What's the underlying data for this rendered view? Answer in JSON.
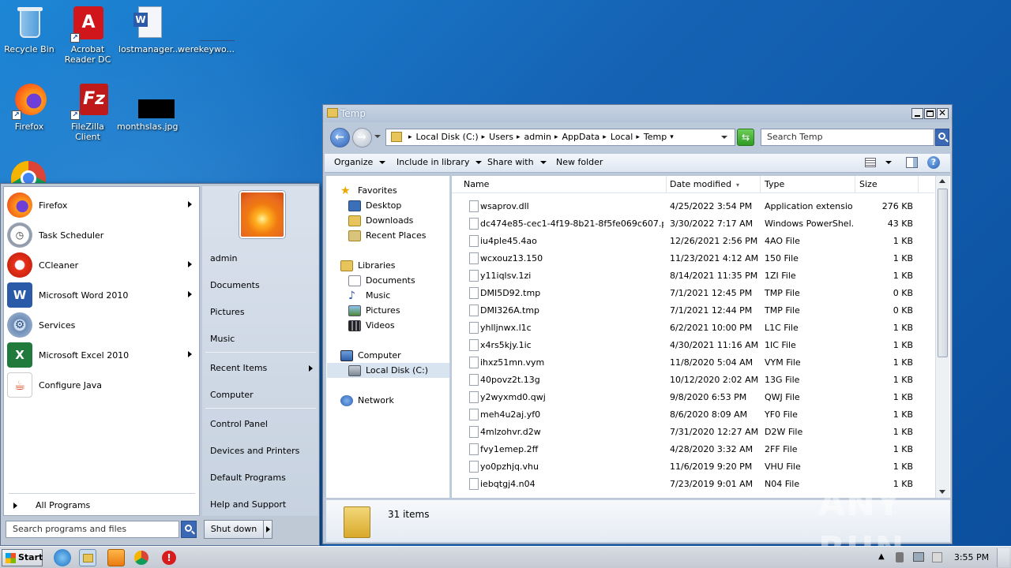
{
  "desktop": {
    "icons": [
      {
        "label": "Recycle Bin"
      },
      {
        "label": "Acrobat Reader DC"
      },
      {
        "label": "lostmanager..."
      },
      {
        "label": "werekeywo..."
      },
      {
        "label": "Firefox"
      },
      {
        "label": "FileZilla Client"
      },
      {
        "label": "monthslas.jpg"
      }
    ]
  },
  "start_menu": {
    "programs": [
      {
        "label": "Firefox",
        "has_submenu": true
      },
      {
        "label": "Task Scheduler",
        "has_submenu": false
      },
      {
        "label": "CCleaner",
        "has_submenu": true
      },
      {
        "label": "Microsoft Word 2010",
        "has_submenu": true
      },
      {
        "label": "Services",
        "has_submenu": false
      },
      {
        "label": "Microsoft Excel 2010",
        "has_submenu": true
      },
      {
        "label": "Configure Java",
        "has_submenu": false
      }
    ],
    "all_programs": "All Programs",
    "search_placeholder": "Search programs and files",
    "right_items": {
      "admin": "admin",
      "documents": "Documents",
      "pictures": "Pictures",
      "music": "Music",
      "recent": "Recent Items",
      "computer": "Computer",
      "control_panel": "Control Panel",
      "devices": "Devices and Printers",
      "default_programs": "Default Programs",
      "help": "Help and Support"
    },
    "shutdown": "Shut down"
  },
  "explorer": {
    "title": "Temp",
    "breadcrumbs": [
      "Local Disk (C:)",
      "Users",
      "admin",
      "AppData",
      "Local",
      "Temp"
    ],
    "search_placeholder": "Search Temp",
    "toolbar": {
      "organize": "Organize",
      "include": "Include in library",
      "share": "Share with",
      "new_folder": "New folder"
    },
    "nav": {
      "favorites": "Favorites",
      "desktop": "Desktop",
      "downloads": "Downloads",
      "recent": "Recent Places",
      "libraries": "Libraries",
      "documents": "Documents",
      "music": "Music",
      "pictures": "Pictures",
      "videos": "Videos",
      "computer": "Computer",
      "local_disk": "Local Disk (C:)",
      "network": "Network"
    },
    "columns": {
      "name": "Name",
      "date": "Date modified",
      "type": "Type",
      "size": "Size"
    },
    "files": [
      {
        "name": "wsaprov.dll",
        "date": "4/25/2022 3:54 PM",
        "type": "Application extension",
        "size": "276 KB"
      },
      {
        "name": "dc474e85-cec1-4f19-8b21-8f5fe069c607.ps1",
        "date": "3/30/2022 7:17 AM",
        "type": "Windows PowerShel...",
        "size": "43 KB"
      },
      {
        "name": "iu4ple45.4ao",
        "date": "12/26/2021 2:56 PM",
        "type": "4AO File",
        "size": "1 KB"
      },
      {
        "name": "wcxouz13.150",
        "date": "11/23/2021 4:12 AM",
        "type": "150 File",
        "size": "1 KB"
      },
      {
        "name": "y11iqlsv.1zi",
        "date": "8/14/2021 11:35 PM",
        "type": "1ZI File",
        "size": "1 KB"
      },
      {
        "name": "DMI5D92.tmp",
        "date": "7/1/2021 12:45 PM",
        "type": "TMP File",
        "size": "0 KB"
      },
      {
        "name": "DMI326A.tmp",
        "date": "7/1/2021 12:44 PM",
        "type": "TMP File",
        "size": "0 KB"
      },
      {
        "name": "yhlljnwx.l1c",
        "date": "6/2/2021 10:00 PM",
        "type": "L1C File",
        "size": "1 KB"
      },
      {
        "name": "x4rs5kjy.1ic",
        "date": "4/30/2021 11:16 AM",
        "type": "1IC File",
        "size": "1 KB"
      },
      {
        "name": "ihxz51mn.vym",
        "date": "11/8/2020 5:04 AM",
        "type": "VYM File",
        "size": "1 KB"
      },
      {
        "name": "40povz2t.13g",
        "date": "10/12/2020 2:02 AM",
        "type": "13G File",
        "size": "1 KB"
      },
      {
        "name": "y2wyxmd0.qwj",
        "date": "9/8/2020 6:53 PM",
        "type": "QWJ File",
        "size": "1 KB"
      },
      {
        "name": "meh4u2aj.yf0",
        "date": "8/6/2020 8:09 AM",
        "type": "YF0 File",
        "size": "1 KB"
      },
      {
        "name": "4mlzohvr.d2w",
        "date": "7/31/2020 12:27 AM",
        "type": "D2W File",
        "size": "1 KB"
      },
      {
        "name": "fvy1emep.2ff",
        "date": "4/28/2020 3:32 AM",
        "type": "2FF File",
        "size": "1 KB"
      },
      {
        "name": "yo0pzhjq.vhu",
        "date": "11/6/2019 9:20 PM",
        "type": "VHU File",
        "size": "1 KB"
      },
      {
        "name": "iebqtgj4.n04",
        "date": "7/23/2019 9:01 AM",
        "type": "N04 File",
        "size": "1 KB"
      }
    ],
    "item_count": "31 items"
  },
  "taskbar": {
    "start": "Start",
    "clock": "3:55 PM"
  },
  "watermark": "ANY RUN",
  "colors": {
    "desktop": "#1562b4",
    "accent": "#3a68b4",
    "start_menu": "#bfc9d6"
  }
}
